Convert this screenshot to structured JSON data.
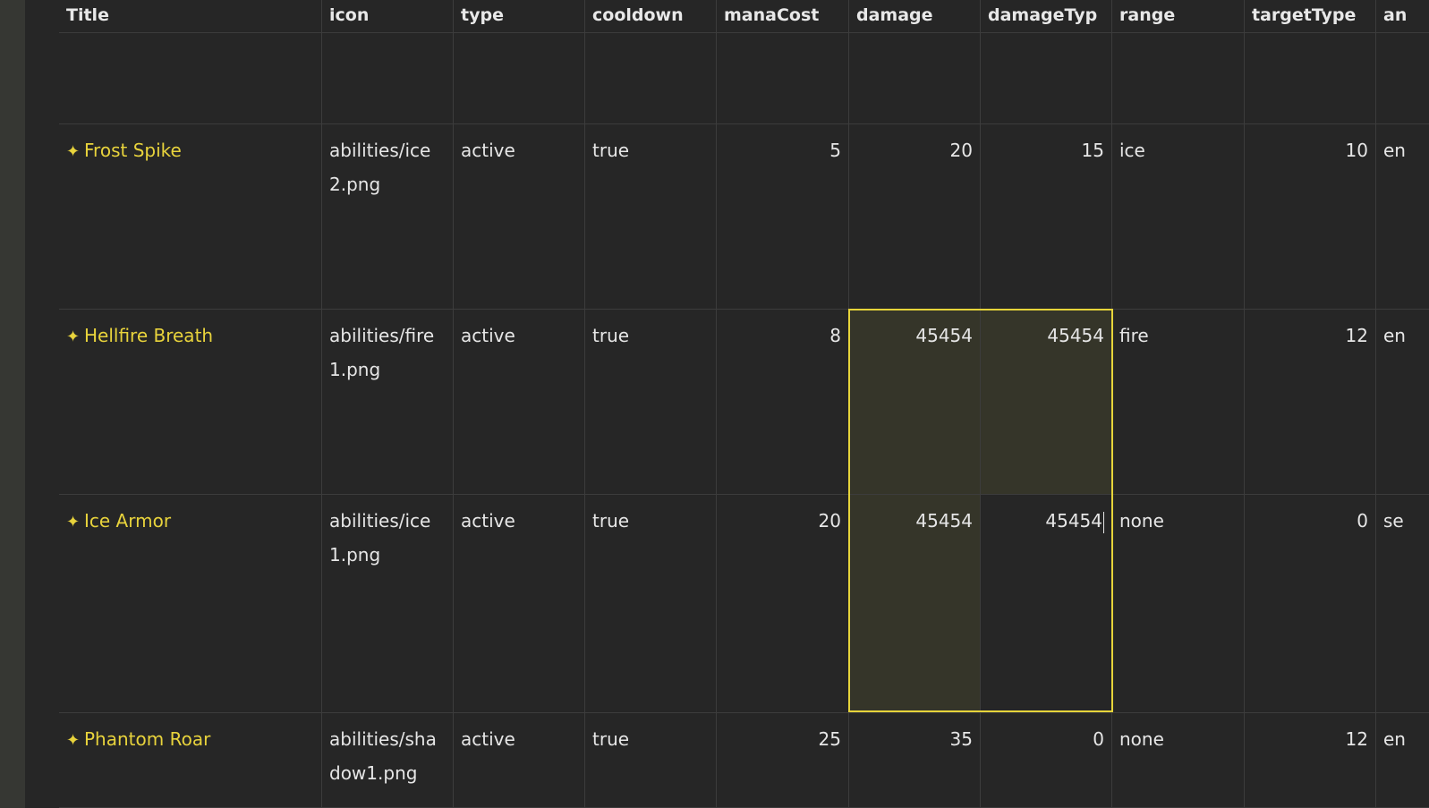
{
  "columns": [
    "Title",
    "icon",
    "type",
    "cooldown",
    "manaCost",
    "damage",
    "damageType",
    "range",
    "targetType",
    "an"
  ],
  "rows": [
    {
      "title": "",
      "icon": "",
      "type": "",
      "cooldown": "",
      "manaCost": "",
      "damage": "",
      "damageType": "",
      "range": "",
      "targetType": "",
      "an": ""
    },
    {
      "title": "Frost Spike",
      "icon": "abilities/ice2.png",
      "type": "active",
      "cooldown": "true",
      "manaCost": "5",
      "damage": "20",
      "damageType": "15",
      "range": "ice",
      "targetType": "10",
      "an": "en"
    },
    {
      "title": "Hellfire Breath",
      "icon": "abilities/fire1.png",
      "type": "active",
      "cooldown": "true",
      "manaCost": "8",
      "damage": "45454",
      "damageType": "45454",
      "range": "fire",
      "targetType": "12",
      "an": "en"
    },
    {
      "title": "Ice Armor",
      "icon": "abilities/ice1.png",
      "type": "active",
      "cooldown": "true",
      "manaCost": "20",
      "damage": "45454",
      "damageType": "45454",
      "range": "none",
      "targetType": "0",
      "an": "se"
    },
    {
      "title": "Phantom Roar",
      "icon": "abilities/shadow1.png",
      "type": "active",
      "cooldown": "true",
      "manaCost": "25",
      "damage": "35",
      "damageType": "0",
      "range": "none",
      "targetType": "12",
      "an": "en"
    }
  ],
  "icons": {
    "title_row_icon": "sparkle-icon"
  },
  "colors": {
    "accent": "#e6d43a",
    "background": "#262626",
    "title_text": "#e8d33c"
  }
}
